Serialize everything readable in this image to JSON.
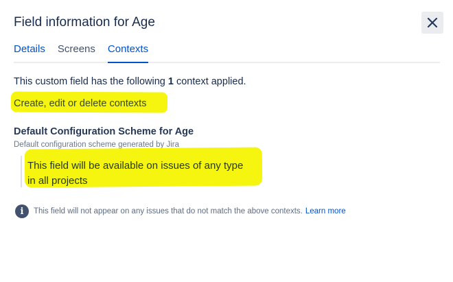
{
  "dialog": {
    "title": "Field information for Age",
    "close_icon": "close-icon"
  },
  "tabs": [
    {
      "label": "Details",
      "active": false
    },
    {
      "label": "Screens",
      "active": false
    },
    {
      "label": "Contexts",
      "active": true
    }
  ],
  "contexts": {
    "applied_prefix": "This custom field has the following",
    "applied_count": "1",
    "applied_suffix": "context applied.",
    "manage_link": "Create, edit or delete contexts"
  },
  "scheme": {
    "name": "Default Configuration Scheme for Age",
    "description": "Default configuration scheme generated by Jira",
    "availability_line1": "This field will be available on issues of any type",
    "availability_line2": "in all projects"
  },
  "info": {
    "icon": "info-icon",
    "message": "This field will not appear on any issues that do not match the above contexts.",
    "link": "Learn more"
  },
  "colors": {
    "highlight": "#f5f50f",
    "accent": "#0052cc",
    "text": "#172b4d"
  }
}
